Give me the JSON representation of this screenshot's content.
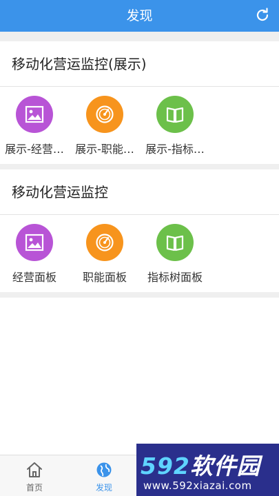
{
  "header": {
    "title": "发现",
    "refresh_icon": "refresh-icon"
  },
  "sections": [
    {
      "title": "移动化营运监控(展示)",
      "items": [
        {
          "label": "展示-经营…",
          "icon": "image-icon",
          "color": "#b854d6"
        },
        {
          "label": "展示-职能…",
          "icon": "gauge-icon",
          "color": "#f7941d"
        },
        {
          "label": "展示-指标…",
          "icon": "book-icon",
          "color": "#6cc04a"
        }
      ]
    },
    {
      "title": "移动化营运监控",
      "items": [
        {
          "label": "经营面板",
          "icon": "image-icon",
          "color": "#b854d6"
        },
        {
          "label": "职能面板",
          "icon": "gauge-icon",
          "color": "#f7941d"
        },
        {
          "label": "指标树面板",
          "icon": "book-icon",
          "color": "#6cc04a"
        }
      ]
    }
  ],
  "tabbar": {
    "tabs": [
      {
        "label": "首页",
        "icon": "home-icon",
        "active": false
      },
      {
        "label": "发现",
        "icon": "globe-icon",
        "active": true
      }
    ],
    "active_color": "#3b93ea",
    "inactive_color": "#666666"
  },
  "watermark": {
    "brand_num": "592",
    "brand_text": "软件园",
    "url": "www.592xiazai.com"
  }
}
